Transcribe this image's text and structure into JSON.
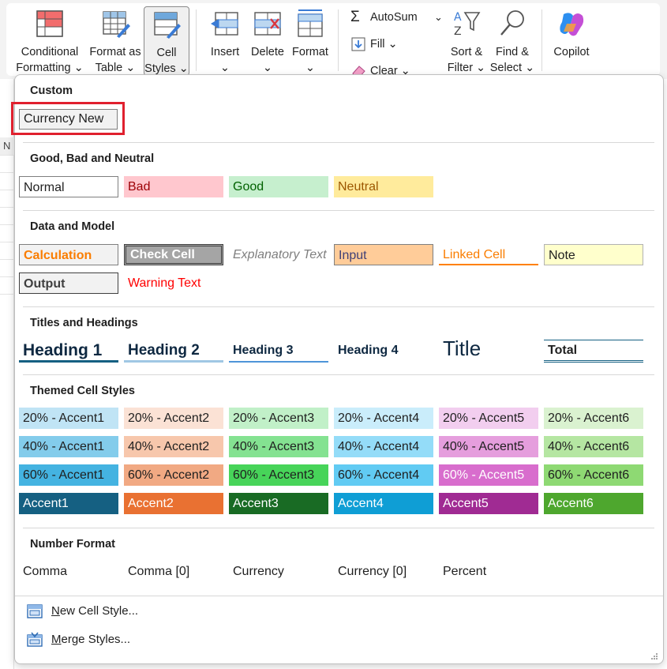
{
  "ribbon": {
    "conditional_formatting": "Conditional\nFormatting ⌄",
    "format_as_table": "Format as\nTable ⌄",
    "cell_styles": "Cell\nStyles ⌄",
    "insert": "Insert\n⌄",
    "delete": "Delete\n⌄",
    "format": "Format\n⌄",
    "autosum": "AutoSum",
    "autosum_chevron": "⌄",
    "fill": "Fill ⌄",
    "clear": "Clear ⌄",
    "sort_filter": "Sort &\nFilter ⌄",
    "find_select": "Find &\nSelect ⌄",
    "copilot": "Copilot"
  },
  "sheet": {
    "column_header": "N"
  },
  "panel": {
    "custom": {
      "title": "Custom",
      "items": [
        {
          "label": "Currency New"
        }
      ]
    },
    "good_bad_neutral": {
      "title": "Good, Bad and Neutral",
      "items": [
        {
          "label": "Normal",
          "bg": "#ffffff",
          "fg": "#1f1f1f",
          "border": "#7f7f7f"
        },
        {
          "label": "Bad",
          "bg": "#ffc7ce",
          "fg": "#9c0006"
        },
        {
          "label": "Good",
          "bg": "#c6efce",
          "fg": "#006100"
        },
        {
          "label": "Neutral",
          "bg": "#ffeb9c",
          "fg": "#9c5700"
        }
      ]
    },
    "data_model": {
      "title": "Data and Model",
      "items": [
        {
          "label": "Calculation",
          "bg": "#f2f2f2",
          "fg": "#fa7d00",
          "border": "#7f7f7f",
          "bold": true
        },
        {
          "label": "Check Cell",
          "bg": "#a5a5a5",
          "fg": "#ffffff",
          "border": "#3f3f3f",
          "bold": true,
          "double": true
        },
        {
          "label": "Explanatory Text",
          "bg": "#ffffff",
          "fg": "#7f7f7f",
          "italic": true
        },
        {
          "label": "Input",
          "bg": "#ffcc99",
          "fg": "#3f3f76",
          "border": "#7f7f7f"
        },
        {
          "label": "Linked Cell",
          "bg": "#ffffff",
          "fg": "#fa7d00",
          "underline": "#ff8001"
        },
        {
          "label": "Note",
          "bg": "#ffffcc",
          "fg": "#1f1f1f",
          "border": "#b2b2b2"
        },
        {
          "label": "Output",
          "bg": "#f2f2f2",
          "fg": "#3f3f3f",
          "border": "#3f3f3f",
          "bold": true
        },
        {
          "label": "Warning Text",
          "bg": "#ffffff",
          "fg": "#ff0000"
        }
      ]
    },
    "titles_headings": {
      "title": "Titles and Headings",
      "items": [
        {
          "label": "Heading 1",
          "fg": "#0e2841",
          "size": 21,
          "bold": true,
          "underline": "#156082",
          "uw": 3
        },
        {
          "label": "Heading 2",
          "fg": "#0e2841",
          "size": 19,
          "bold": true,
          "underline": "#a0c7e4",
          "uw": 3
        },
        {
          "label": "Heading 3",
          "fg": "#0e2841",
          "size": 16,
          "bold": true,
          "underline": "#4e95d9",
          "uw": 2
        },
        {
          "label": "Heading 4",
          "fg": "#0e2841",
          "size": 16,
          "bold": true
        },
        {
          "label": "Title",
          "fg": "#0e2841",
          "size": 26,
          "bold": false
        },
        {
          "label": "Total",
          "fg": "#1f1f1f",
          "size": 16,
          "bold": true,
          "total": true
        }
      ]
    },
    "themed": {
      "title": "Themed Cell Styles",
      "rows": [
        [
          {
            "label": "20% - Accent1",
            "bg": "#c0e4f5"
          },
          {
            "label": "20% - Accent2",
            "bg": "#fbe2d5"
          },
          {
            "label": "20% - Accent3",
            "bg": "#c1f0c8"
          },
          {
            "label": "20% - Accent4",
            "bg": "#caedfb"
          },
          {
            "label": "20% - Accent5",
            "bg": "#f2ceef"
          },
          {
            "label": "20% - Accent6",
            "bg": "#daf2d0"
          }
        ],
        [
          {
            "label": "40% - Accent1",
            "bg": "#83cceb"
          },
          {
            "label": "40% - Accent2",
            "bg": "#f7c7ac"
          },
          {
            "label": "40% - Accent3",
            "bg": "#84e291"
          },
          {
            "label": "40% - Accent4",
            "bg": "#94dcf8"
          },
          {
            "label": "40% - Accent5",
            "bg": "#e59edd"
          },
          {
            "label": "40% - Accent6",
            "bg": "#b5e6a2"
          }
        ],
        [
          {
            "label": "60% - Accent1",
            "bg": "#44b3e1"
          },
          {
            "label": "60% - Accent2",
            "bg": "#f1a983"
          },
          {
            "label": "60% - Accent3",
            "bg": "#47d459"
          },
          {
            "label": "60% - Accent4",
            "bg": "#61cbf3"
          },
          {
            "label": "60% - Accent5",
            "bg": "#d86dcd",
            "fg": "#ffffff"
          },
          {
            "label": "60% - Accent6",
            "bg": "#8ed973"
          }
        ],
        [
          {
            "label": "Accent1",
            "bg": "#156082",
            "fg": "#ffffff"
          },
          {
            "label": "Accent2",
            "bg": "#e97132",
            "fg": "#ffffff"
          },
          {
            "label": "Accent3",
            "bg": "#196b24",
            "fg": "#ffffff"
          },
          {
            "label": "Accent4",
            "bg": "#0f9ed5",
            "fg": "#ffffff"
          },
          {
            "label": "Accent5",
            "bg": "#a02b93",
            "fg": "#ffffff"
          },
          {
            "label": "Accent6",
            "bg": "#4ea72e",
            "fg": "#ffffff"
          }
        ]
      ]
    },
    "number_format": {
      "title": "Number Format",
      "items": [
        {
          "label": "Comma"
        },
        {
          "label": "Comma [0]"
        },
        {
          "label": "Currency"
        },
        {
          "label": "Currency [0]"
        },
        {
          "label": "Percent"
        }
      ]
    },
    "menu": {
      "new_style": {
        "underline": "N",
        "rest": "ew Cell Style..."
      },
      "merge_styles": {
        "underline": "M",
        "rest": "erge Styles..."
      }
    }
  },
  "colors": {
    "highlight": "#e0202e",
    "cell_styles_border": "#8a8a8a"
  }
}
